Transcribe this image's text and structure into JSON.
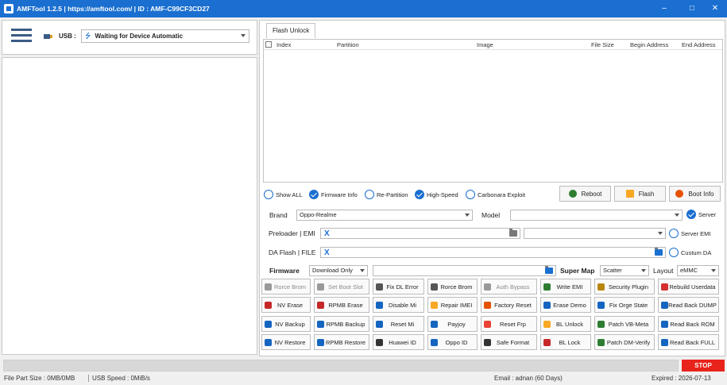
{
  "window": {
    "title": "AMFTool 1.2.5 | https://amftool.com/ | ID : AMF-C99CF3CD27",
    "minimize": "–",
    "maximize": "□",
    "close": "✕"
  },
  "usb": {
    "label": "USB :",
    "selected": "Waiting for Device Automatic"
  },
  "tabs": [
    {
      "label": "Flash Unlock"
    }
  ],
  "table": {
    "columns": [
      "Index",
      "Partition",
      "Image",
      "File Size",
      "Begin Address",
      "End Address"
    ]
  },
  "options": [
    {
      "label": "Show ALL",
      "checked": false
    },
    {
      "label": "Firmware Info",
      "checked": true
    },
    {
      "label": "Re-Partition",
      "checked": false
    },
    {
      "label": "High-Speed",
      "checked": true
    },
    {
      "label": "Carbonara Exploit",
      "checked": false
    }
  ],
  "actions": {
    "reboot": "Reboot",
    "flash": "Flash",
    "boot_info": "Boot Info"
  },
  "form": {
    "brand_label": "Brand",
    "brand_value": "Oppo-Realme",
    "model_label": "Model",
    "model_value": "",
    "server_label": "Server",
    "server_checked": true,
    "preloader_label": "Preloader | EMI",
    "preloader_value": "X",
    "server_emi_label": "Server EMI",
    "server_emi_checked": false,
    "da_label": "DA Flash | FILE",
    "da_value": "X",
    "custom_da_label": "Custum DA",
    "custom_da_checked": false,
    "firmware_label": "Firmware",
    "firmware_mode": "Download Only",
    "super_map_label": "Super Map",
    "super_map_value": "Scatter",
    "layout_label": "Layout",
    "layout_value": "eMMC"
  },
  "buttons": [
    [
      {
        "label": "Rorce Brom",
        "icon": "dots-icon",
        "color": "#999999",
        "disabled": true
      },
      {
        "label": "Set Boot Slot",
        "icon": "branch-icon",
        "color": "#999999",
        "disabled": true
      },
      {
        "label": "Fix DL Error",
        "icon": "tool-icon",
        "color": "#555555",
        "disabled": false
      },
      {
        "label": "Rorce Brom",
        "icon": "dots-icon",
        "color": "#555555",
        "disabled": false
      },
      {
        "label": "Auth Bypass",
        "icon": "shield-icon",
        "color": "#999999",
        "disabled": true
      },
      {
        "label": "Write EMI",
        "icon": "layers-icon",
        "color": "#2e7d32",
        "disabled": false
      },
      {
        "label": "Security Plugin",
        "icon": "plugin-icon",
        "color": "#b8860b",
        "disabled": false
      },
      {
        "label": "Rebuild Userdata",
        "icon": "heart-icon",
        "color": "#d32f2f",
        "disabled": false
      }
    ],
    [
      {
        "label": "NV Erase",
        "icon": "nv-erase-icon",
        "color": "#c62828",
        "disabled": false
      },
      {
        "label": "RPMB Erase",
        "icon": "rpmb-erase-icon",
        "color": "#c62828",
        "disabled": false
      },
      {
        "label": "Disable Mi",
        "icon": "brush-icon",
        "color": "#1565c0",
        "disabled": false
      },
      {
        "label": "Repair IMEI",
        "icon": "sun-icon",
        "color": "#f9a825",
        "disabled": false
      },
      {
        "label": "Factory Reset",
        "icon": "broom-icon",
        "color": "#e65100",
        "disabled": false
      },
      {
        "label": "Erase Demo",
        "icon": "link-icon",
        "color": "#1565c0",
        "disabled": false
      },
      {
        "label": "Fix Orge State",
        "icon": "bracket-icon",
        "color": "#1565c0",
        "disabled": false
      },
      {
        "label": "Read Back DUMP",
        "icon": "grid-icon",
        "color": "#1565c0",
        "disabled": false
      }
    ],
    [
      {
        "label": "NV Backup",
        "icon": "nv-backup-icon",
        "color": "#1565c0",
        "disabled": false
      },
      {
        "label": "RPMB Backup",
        "icon": "rpmb-backup-icon",
        "color": "#1565c0",
        "disabled": false
      },
      {
        "label": "Reset Mi",
        "icon": "mi-icon",
        "color": "#1565c0",
        "disabled": false
      },
      {
        "label": "Payjoy",
        "icon": "payjoy-icon",
        "color": "#1565c0",
        "disabled": false
      },
      {
        "label": "Reset Frp",
        "icon": "google-icon",
        "color": "#ea4335",
        "disabled": false
      },
      {
        "label": "BL Unlock",
        "icon": "unlock-icon",
        "color": "#f9a825",
        "disabled": false
      },
      {
        "label": "Patch VB-Meta",
        "icon": "patch-icon",
        "color": "#2e7d32",
        "disabled": false
      },
      {
        "label": "Read Back ROM",
        "icon": "rom-icon",
        "color": "#1565c0",
        "disabled": false
      }
    ],
    [
      {
        "label": "NV Restore",
        "icon": "nv-restore-icon",
        "color": "#1565c0",
        "disabled": false
      },
      {
        "label": "RPMB Restore",
        "icon": "rpmb-restore-icon",
        "color": "#1565c0",
        "disabled": false
      },
      {
        "label": "Huawei ID",
        "icon": "huawei-icon",
        "color": "#333333",
        "disabled": false
      },
      {
        "label": "Oppo ID",
        "icon": "arrows-icon",
        "color": "#1565c0",
        "disabled": false
      },
      {
        "label": "Safe Format",
        "icon": "format-icon",
        "color": "#333333",
        "disabled": false
      },
      {
        "label": "BL Lock",
        "icon": "lock-icon",
        "color": "#c62828",
        "disabled": false
      },
      {
        "label": "Patch DM-Verify",
        "icon": "patch-dm-icon",
        "color": "#2e7d32",
        "disabled": false
      },
      {
        "label": "Read Back FULL",
        "icon": "full-icon",
        "color": "#1565c0",
        "disabled": false
      }
    ]
  ],
  "status": {
    "stop": "STOP",
    "file_part_size": "File Part Size : 0MB/0MB",
    "usb_speed": "USB Speed : 0MiB/s",
    "email": "Email : adnan (60 Days)",
    "expired": "Expired : 2026-07-13"
  },
  "colors": {
    "titlebar": "#1a6fd0",
    "accent": "#1a6fd0",
    "stop": "#e8231b"
  }
}
